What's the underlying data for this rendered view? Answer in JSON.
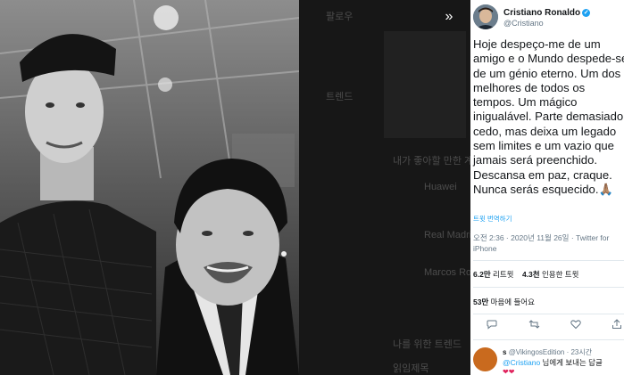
{
  "viewer": {
    "expand_icon": "chevrons-right-icon",
    "background_lines": [
      "팔로우",
      "트렌드",
      "내가 좋아할 만한 계정",
      "Huawei",
      "Real Madrid",
      "Marcos Rojo",
      "나를 위한 트렌드",
      "읽임제목"
    ]
  },
  "tweet": {
    "author_name": "Cristiano Ronaldo",
    "author_handle": "@Cristiano",
    "text": "Hoje despeço-me de um amigo e o Mundo despede-se de um génio eterno. Um dos melhores de todos os tempos. Um mágico inigualável. Parte demasiado cedo, mas deixa um legado sem limites e um vazio que jamais será preenchido. Descansa em paz, craque. Nunca serás esquecido.🙏🏽",
    "translate_label": "트윗 번역하기",
    "timestamp": "오전 2:36 · 2020년 11월 26일 · Twitter for iPhone",
    "retweets_count": "6.2만",
    "retweets_label": "리트윗",
    "quotes_count": "4.3천",
    "quotes_label": "인용한 트윗",
    "likes_count": "53만",
    "likes_label": "마음에 들어요"
  },
  "actions": [
    {
      "name": "reply-icon",
      "glyph": "💬"
    },
    {
      "name": "retweet-icon",
      "glyph": "⟲"
    },
    {
      "name": "like-icon",
      "glyph": "♡"
    },
    {
      "name": "share-icon",
      "glyph": "⇪"
    }
  ],
  "reply": {
    "author": "s",
    "handle": "@VikingosEdition · 23시간",
    "mention": "@Cristiano",
    "text": " 님에게 보내는 답글",
    "hearts": "❤❤"
  },
  "colors": {
    "accent": "#1da1f2",
    "text": "#14171a",
    "muted": "#657786"
  }
}
